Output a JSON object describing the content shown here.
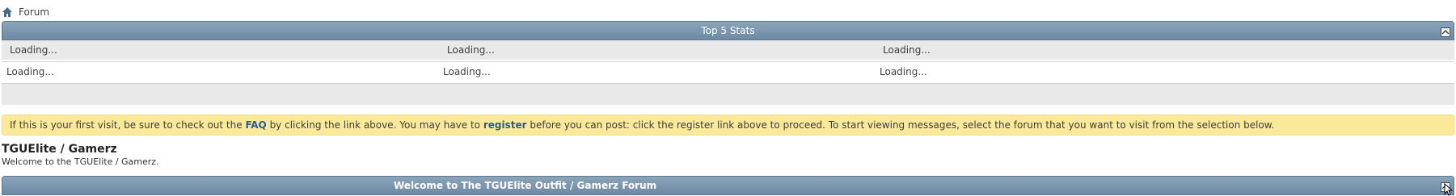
{
  "breadcrumb": {
    "label": "Forum",
    "icon": "home-icon"
  },
  "stats": {
    "title": "Top 5 Stats",
    "row1": [
      "Loading...",
      "Loading...",
      "Loading..."
    ],
    "row2": [
      "Loading...",
      "Loading...",
      "Loading..."
    ]
  },
  "notice": {
    "part1": "If this is your first visit, be sure to check out the ",
    "faq_link": "FAQ",
    "part2": " by clicking the link above. You may have to ",
    "register_link": "register",
    "part3": " before you can post: click the register link above to proceed. To start viewing messages, select the forum that you want to visit from the selection below."
  },
  "forum": {
    "title": "TGUElite / Gamerz",
    "description": "Welcome to the TGUElite / Gamerz."
  },
  "welcome": {
    "title": "Welcome to The TGUElite Outfit / Gamerz Forum"
  },
  "colors": {
    "bar": "#7992a8",
    "notice": "#fbe99a",
    "link": "#2b5f8a"
  }
}
